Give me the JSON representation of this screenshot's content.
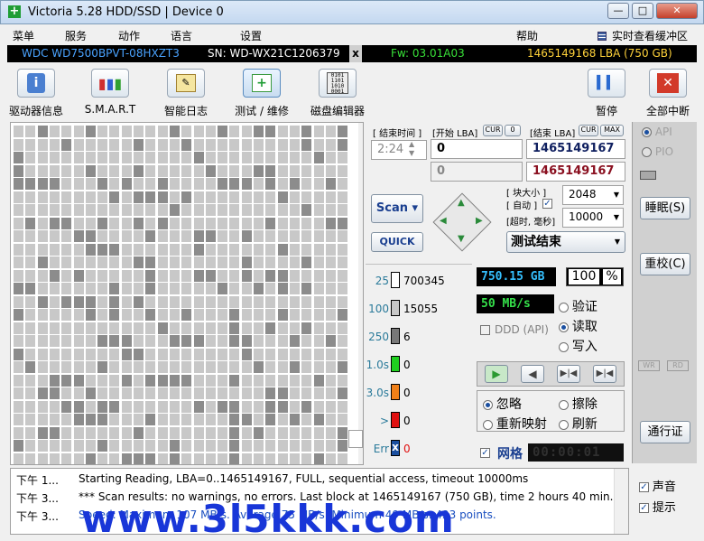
{
  "window": {
    "title": "Victoria 5.28 HDD/SSD | Device 0",
    "min": "—",
    "max": "□",
    "close": "✕"
  },
  "menu": {
    "items": [
      "菜单",
      "服务",
      "动作",
      "语言",
      "设置",
      "帮助"
    ],
    "right_label": "实时查看缓冲区"
  },
  "device": {
    "model": "WDC WD7500BPVT-08HXZT3",
    "serial": "SN: WD-WX21C1206379",
    "x": "x",
    "firmware": "Fw: 03.01A03",
    "capacity": "1465149168 LBA (750 GB)"
  },
  "toolbar": {
    "items": [
      {
        "label": "驱动器信息",
        "icon": "info-icon"
      },
      {
        "label": "S.M.A.R.T",
        "icon": "smart-icon"
      },
      {
        "label": "智能日志",
        "icon": "log-icon"
      },
      {
        "label": "测试 / 维修",
        "icon": "test-icon"
      },
      {
        "label": "磁盘编辑器",
        "icon": "disk-editor-icon"
      }
    ],
    "pause": "暂停",
    "abort": "全部中断"
  },
  "scan": {
    "elapsed_label": "[ 结束时间 ]",
    "elapsed": "2:24",
    "start_label": "[开始 LBA]",
    "cur": "CUR",
    "start_cur_value": "0",
    "end_label": "[结束 LBA]",
    "max": "MAX",
    "start_lba": "0",
    "end_lba": "1465149167",
    "start_lba2": "0",
    "end_lba2": "1465149167",
    "scan_button": "Scan",
    "quick_button": "QUICK",
    "block_size_label": "[ 块大小 ]",
    "auto_label": "[ 自动 ]",
    "block_size": "2048",
    "timeout_label": "[超时, 毫秒]",
    "timeout": "10000",
    "status": "测试结束"
  },
  "stats": [
    {
      "label": "25",
      "value": "700345",
      "color": "#ffffff"
    },
    {
      "label": "100",
      "value": "15055",
      "color": "#c8c8c8"
    },
    {
      "label": "250",
      "value": "6",
      "color": "#787878"
    },
    {
      "label": "1.0s",
      "value": "0",
      "color": "#20d020"
    },
    {
      "label": "3.0s",
      "value": "0",
      "color": "#f08018"
    },
    {
      "label": ">",
      "value": "0",
      "color": "#e01010"
    },
    {
      "label": "Err",
      "value": "0",
      "color": "#1a4fa0"
    }
  ],
  "perf": {
    "size": "750.15 GB",
    "percent": "100",
    "percent_unit": "%",
    "speed": "50 MB/s",
    "ddd": "DDD (API)",
    "modes": [
      "验证",
      "读取",
      "写入"
    ],
    "actions": [
      "忽略",
      "擦除",
      "重新映射",
      "刷新"
    ],
    "grid_label": "网格",
    "timer": "00:00:01"
  },
  "side": {
    "api": "API",
    "pio": "PIO",
    "sleep": "睡眠(S)",
    "recal": "重校(C)",
    "wr": "WR",
    "rd": "RD",
    "passport": "通行证",
    "sound": "声音",
    "hint": "提示"
  },
  "log": [
    {
      "time": "下午 1...",
      "msg": "Starting Reading, LBA=0..1465149167, FULL, sequential access, timeout 10000ms"
    },
    {
      "time": "下午 3...",
      "msg": "*** Scan results: no warnings, no errors. Last block at 1465149167 (750 GB), time 2 hours 40 min..."
    },
    {
      "time": "下午 3...",
      "msg": "Speed: Maximum 107 MB/s. Average 75 MB/s. Minimum 49 MB/s. 423 points."
    }
  ],
  "watermark": "www.3l5kkk.com"
}
